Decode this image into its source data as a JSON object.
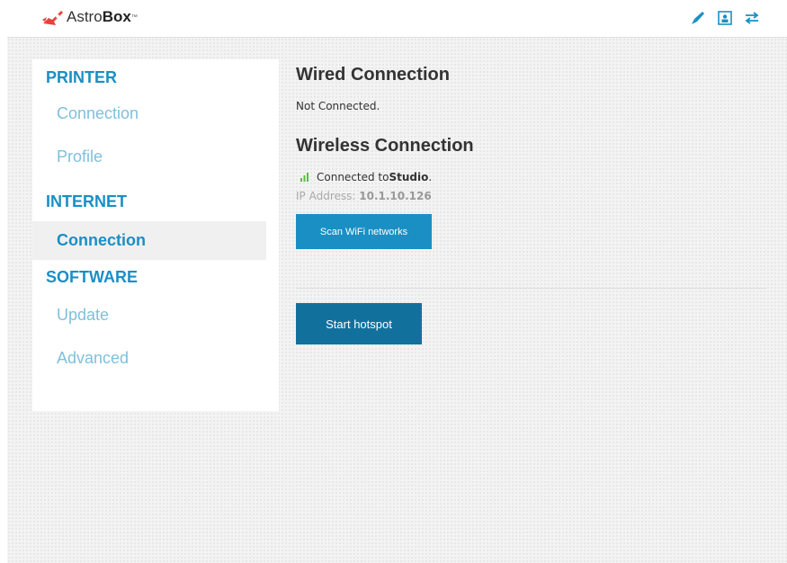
{
  "header": {
    "logo_light": "Astro",
    "logo_bold": "Box",
    "logo_tm": "™",
    "icons": [
      "rocket-icon",
      "contact-card-icon",
      "transfer-arrows-icon"
    ]
  },
  "sidebar": {
    "sections": [
      {
        "title": "PRINTER",
        "items": [
          "Connection",
          "Profile"
        ]
      },
      {
        "title": "INTERNET",
        "items": [
          "Connection"
        ]
      },
      {
        "title": "SOFTWARE",
        "items": [
          "Update",
          "Advanced"
        ]
      }
    ],
    "active": "INTERNET / Connection"
  },
  "main": {
    "wired_title": "Wired Connection",
    "wired_status": "Not Connected.",
    "wireless_title": "Wireless Connection",
    "wireless_prefix": "Connected to ",
    "wireless_network": "Studio",
    "wireless_suffix": ".",
    "ip_label": "IP Address: ",
    "ip_value": "10.1.10.126",
    "scan_button": "Scan WiFi networks",
    "hotspot_button": "Start hotspot"
  },
  "colors": {
    "accent": "#1a8fc4",
    "accent_dark": "#12719c",
    "sidebar_item": "#7fc0dc",
    "logo_red": "#e8413c"
  }
}
